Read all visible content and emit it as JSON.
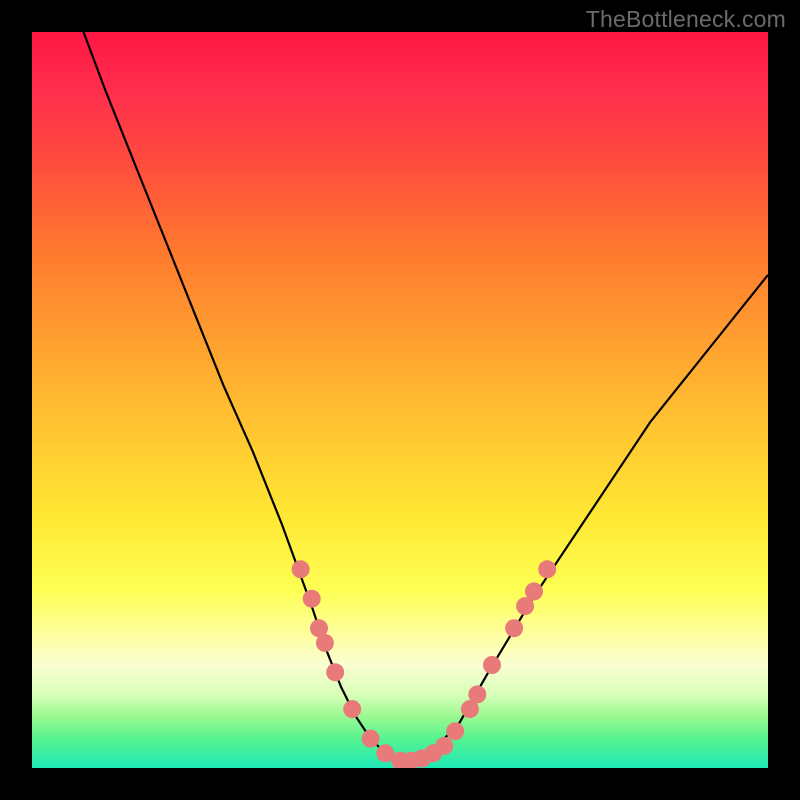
{
  "watermark": "TheBottleneck.com",
  "chart_data": {
    "type": "line",
    "title": "",
    "xlabel": "",
    "ylabel": "",
    "xlim": [
      0,
      100
    ],
    "ylim": [
      0,
      100
    ],
    "series": [
      {
        "name": "curve",
        "x": [
          7,
          10,
          14,
          18,
          22,
          26,
          30,
          34,
          38,
          40,
          42,
          44,
          46,
          48,
          50,
          52,
          54,
          56,
          58,
          62,
          68,
          76,
          84,
          92,
          100
        ],
        "y": [
          100,
          92,
          82,
          72,
          62,
          52,
          43,
          33,
          22,
          16,
          11,
          7,
          4,
          2,
          1,
          1,
          2,
          4,
          6,
          13,
          23,
          35,
          47,
          57,
          67
        ]
      }
    ],
    "markers": [
      {
        "x": 36.5,
        "y": 27
      },
      {
        "x": 38.0,
        "y": 23
      },
      {
        "x": 39.0,
        "y": 19
      },
      {
        "x": 39.8,
        "y": 17
      },
      {
        "x": 41.2,
        "y": 13
      },
      {
        "x": 43.5,
        "y": 8
      },
      {
        "x": 46.0,
        "y": 4
      },
      {
        "x": 48.0,
        "y": 2
      },
      {
        "x": 50.0,
        "y": 1
      },
      {
        "x": 51.5,
        "y": 1
      },
      {
        "x": 53.0,
        "y": 1.3
      },
      {
        "x": 54.5,
        "y": 2
      },
      {
        "x": 56.0,
        "y": 3
      },
      {
        "x": 57.5,
        "y": 5
      },
      {
        "x": 59.5,
        "y": 8
      },
      {
        "x": 60.5,
        "y": 10
      },
      {
        "x": 62.5,
        "y": 14
      },
      {
        "x": 65.5,
        "y": 19
      },
      {
        "x": 67.0,
        "y": 22
      },
      {
        "x": 68.2,
        "y": 24
      },
      {
        "x": 70.0,
        "y": 27
      }
    ],
    "marker_color": "#e87a7a",
    "curve_color": "#000000"
  }
}
